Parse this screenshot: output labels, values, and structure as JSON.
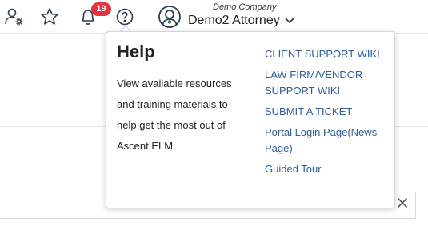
{
  "header": {
    "icons": [
      "user-settings-icon",
      "star-icon",
      "bell-icon",
      "help-icon"
    ],
    "notification_count": "19",
    "company": "Demo Company",
    "user_name": "Demo2 Attorney"
  },
  "help_popup": {
    "title": "Help",
    "description": "View available resources and training materials to help get the most out of Ascent ELM.",
    "links": [
      "CLIENT SUPPORT WIKI",
      "LAW FIRM/VENDOR SUPPORT WIKI",
      "SUBMIT A TICKET",
      "Portal Login Page(News Page)",
      "Guided Tour"
    ]
  },
  "colors": {
    "link": "#2f5d97",
    "badge": "#e5333f",
    "avatar_accent": "#2e7d32",
    "icon": "#2c3e50"
  }
}
